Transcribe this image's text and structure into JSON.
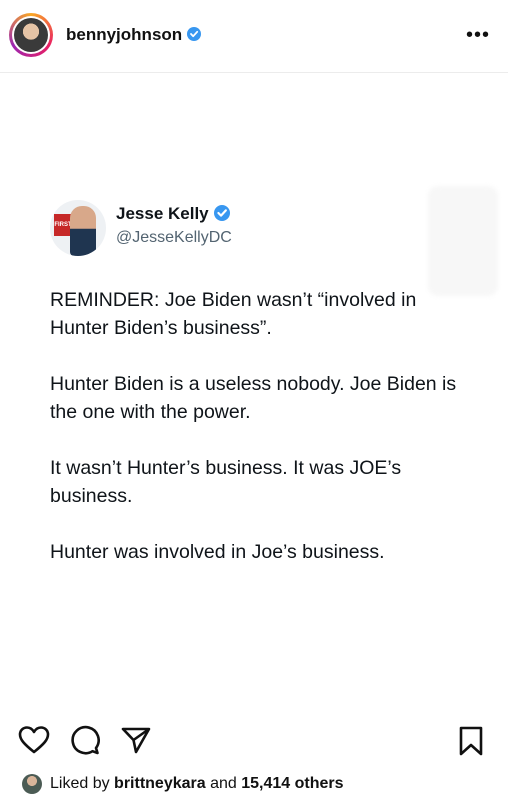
{
  "header": {
    "username": "bennyjohnson",
    "more_label": "•••"
  },
  "tweet": {
    "name": "Jesse Kelly",
    "handle": "@JesseKellyDC",
    "avatar_badge": "FIRST",
    "paragraphs": [
      "REMINDER: Joe Biden wasn’t “involved in Hunter Biden’s business”.",
      "Hunter Biden is a useless nobody. Joe Biden is the one with the power.",
      "It wasn’t Hunter’s business. It was JOE’s business.",
      "Hunter was involved in Joe’s business."
    ]
  },
  "likes": {
    "prefix": "Liked by",
    "liker": "brittneykara",
    "middle": "and",
    "others": "15,414 others"
  },
  "colors": {
    "verified": "#3897f0",
    "text": "#0f1419",
    "handle": "#536471"
  }
}
